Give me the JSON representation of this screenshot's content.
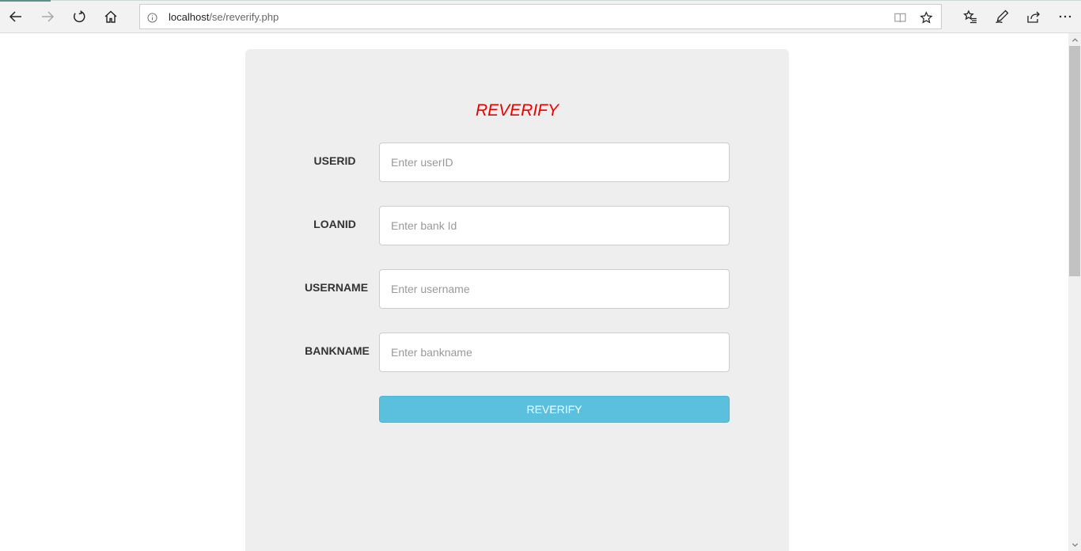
{
  "browser": {
    "url_host": "localhost",
    "url_path": "/se/reverify.php",
    "icons": {
      "back": "back-arrow-icon",
      "forward": "forward-arrow-icon",
      "refresh": "refresh-icon",
      "home": "home-icon",
      "info": "info-icon",
      "reading_view": "reading-view-icon",
      "favorite": "star-icon",
      "favorites_list": "favorites-list-icon",
      "notes": "pen-icon",
      "share": "share-icon",
      "more": "more-dots-icon"
    }
  },
  "form": {
    "title": "REVERIFY",
    "title_color": "#ee0000",
    "fields": [
      {
        "label": "USERID",
        "placeholder": "Enter userID",
        "value": ""
      },
      {
        "label": "LOANID",
        "placeholder": "Enter bank Id",
        "value": ""
      },
      {
        "label": "USERNAME",
        "placeholder": "Enter username",
        "value": ""
      },
      {
        "label": "BANKNAME",
        "placeholder": "Enter bankname",
        "value": ""
      }
    ],
    "submit_label": "REVERIFY",
    "submit_color": "#5bc0de"
  }
}
